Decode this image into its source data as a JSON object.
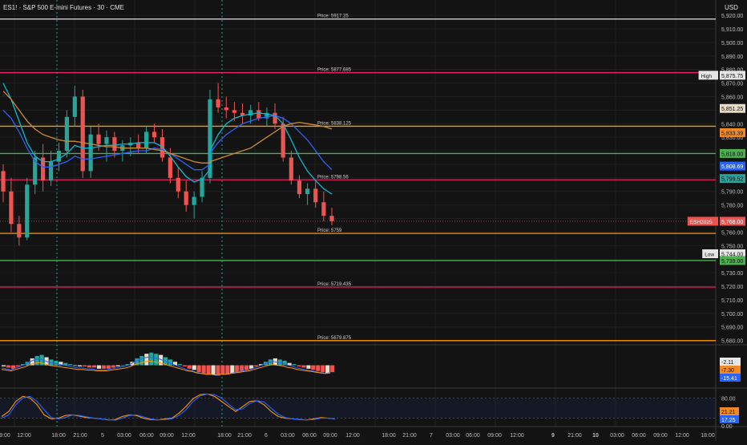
{
  "header": {
    "title": "ES1! · S&P 500 E-mini Futures · 30 · CME",
    "currency": "USD"
  },
  "colors": {
    "bg": "#131313",
    "grid": "#1f1f1f",
    "axis_text": "#bdbdbd",
    "up": "#26a69a",
    "down": "#ef5350",
    "pink": "#e91e63",
    "orange": "#ff9800",
    "green": "#4caf50",
    "white": "#e0e0e0",
    "blue": "#2962ff",
    "teal": "#00bcd4",
    "tan": "#c98a3a"
  },
  "chart_data": [
    {
      "type": "line",
      "name": "main-price",
      "price_axis": [
        "5,920.00",
        "5,910.00",
        "5,900.00",
        "5,890.00",
        "5,880.00",
        "5,870.00",
        "5,860.00",
        "5,850.00",
        "5,840.00",
        "5,830.00",
        "5,820.00",
        "5,810.00",
        "5,800.00",
        "5,790.00",
        "5,780.00",
        "5,770.00",
        "5,760.00",
        "5,750.00",
        "5,740.00",
        "5,730.00",
        "5,720.00",
        "5,710.00",
        "5,700.00",
        "5,690.00",
        "5,680.00"
      ],
      "ylim": [
        5678,
        5923
      ],
      "horizontal_levels": [
        {
          "label": "Price: 5917.25",
          "value": 5917.25,
          "color": "white"
        },
        {
          "label": "Price: 5877.685",
          "value": 5877.685,
          "color": "pink"
        },
        {
          "label": "Price: 5838.125",
          "value": 5838.125,
          "color": "orange"
        },
        {
          "label": "Price: 5798.56",
          "value": 5798.56,
          "color": "pink"
        },
        {
          "label": "Price: 5759",
          "value": 5759,
          "color": "orange"
        },
        {
          "label": "Price: 5719.435",
          "value": 5719.435,
          "color": "pink"
        },
        {
          "label": "Price: 5679.875",
          "value": 5679.875,
          "color": "orange"
        },
        {
          "label": "",
          "value": 5818.0,
          "color": "green"
        },
        {
          "label": "",
          "value": 5739.0,
          "color": "green"
        }
      ],
      "price_tags": [
        {
          "label": "High",
          "text": "5,875.75",
          "value": 5875.75,
          "bg": "#e6e6e6",
          "fg": "#111111"
        },
        {
          "label": "",
          "text": "5,851.25",
          "value": 5851.25,
          "bg": "#e8dccb",
          "fg": "#111111"
        },
        {
          "label": "",
          "text": "5,833.39",
          "value": 5833.39,
          "bg": "#f08a24",
          "fg": "#111111"
        },
        {
          "label": "",
          "text": "5,818.00",
          "value": 5818.0,
          "bg": "#4caf50",
          "fg": "#111111"
        },
        {
          "label": "",
          "text": "5,808.69",
          "value": 5808.69,
          "bg": "#2962ff",
          "fg": "#ffffff"
        },
        {
          "label": "",
          "text": "5,799.52",
          "value": 5799.52,
          "bg": "#26a69a",
          "fg": "#111111"
        },
        {
          "label": "ESH2025",
          "text": "5,768.00",
          "value": 5768.0,
          "bg": "#ef5350",
          "fg": "#ffffff"
        },
        {
          "label": "Low",
          "text": "5,744.00",
          "value": 5744.0,
          "bg": "#e6e6e6",
          "fg": "#111111"
        },
        {
          "label": "",
          "text": "5,739.00",
          "value": 5739.0,
          "bg": "#4caf50",
          "fg": "#111111"
        }
      ],
      "last_price_line": 5768.0,
      "candles": [
        [
          5805,
          5810,
          5782,
          5790
        ],
        [
          5790,
          5800,
          5760,
          5766
        ],
        [
          5766,
          5772,
          5750,
          5756
        ],
        [
          5756,
          5800,
          5754,
          5795
        ],
        [
          5795,
          5820,
          5788,
          5815
        ],
        [
          5815,
          5825,
          5790,
          5798
        ],
        [
          5798,
          5820,
          5794,
          5812
        ],
        [
          5812,
          5826,
          5805,
          5820
        ],
        [
          5820,
          5850,
          5815,
          5845
        ],
        [
          5845,
          5868,
          5838,
          5860
        ],
        [
          5860,
          5865,
          5800,
          5805
        ],
        [
          5805,
          5838,
          5800,
          5832
        ],
        [
          5832,
          5840,
          5820,
          5825
        ],
        [
          5825,
          5835,
          5812,
          5830
        ],
        [
          5830,
          5834,
          5815,
          5820
        ],
        [
          5820,
          5828,
          5812,
          5824
        ],
        [
          5824,
          5830,
          5816,
          5826
        ],
        [
          5826,
          5832,
          5818,
          5822
        ],
        [
          5822,
          5838,
          5818,
          5834
        ],
        [
          5834,
          5840,
          5826,
          5830
        ],
        [
          5830,
          5836,
          5812,
          5815
        ],
        [
          5815,
          5822,
          5796,
          5800
        ],
        [
          5800,
          5808,
          5785,
          5790
        ],
        [
          5790,
          5798,
          5775,
          5780
        ],
        [
          5780,
          5790,
          5770,
          5786
        ],
        [
          5786,
          5805,
          5782,
          5800
        ],
        [
          5800,
          5822,
          5796,
          5818
        ],
        [
          5818,
          5865,
          5814,
          5858
        ],
        [
          5858,
          5870,
          5848,
          5852
        ],
        [
          5852,
          5860,
          5844,
          5850
        ],
        [
          5850,
          5856,
          5842,
          5848
        ],
        [
          5848,
          5855,
          5840,
          5846
        ],
        [
          5846,
          5854,
          5840,
          5850
        ],
        [
          5850,
          5856,
          5842,
          5844
        ],
        [
          5844,
          5852,
          5838,
          5848
        ],
        [
          5848,
          5855,
          5836,
          5840
        ],
        [
          5840,
          5845,
          5812,
          5815
        ],
        [
          5815,
          5820,
          5795,
          5798
        ],
        [
          5798,
          5802,
          5785,
          5788
        ],
        [
          5788,
          5796,
          5780,
          5792
        ],
        [
          5792,
          5798,
          5778,
          5782
        ],
        [
          5782,
          5790,
          5768,
          5772
        ],
        [
          5772,
          5778,
          5765,
          5768
        ]
      ],
      "ma_lines": [
        {
          "color": "blue",
          "values": [
            5850,
            5844,
            5834,
            5822,
            5812,
            5808,
            5808,
            5810,
            5812,
            5816,
            5814,
            5814,
            5815,
            5816,
            5817,
            5818,
            5819,
            5820,
            5820,
            5822,
            5821,
            5818,
            5814,
            5810,
            5806,
            5806,
            5810,
            5818,
            5826,
            5832,
            5836,
            5840,
            5842,
            5844,
            5845,
            5846,
            5844,
            5840,
            5834,
            5828,
            5820,
            5812,
            5806
          ]
        },
        {
          "color": "teal",
          "values": [
            5870,
            5858,
            5842,
            5826,
            5816,
            5812,
            5812,
            5814,
            5818,
            5824,
            5822,
            5822,
            5823,
            5824,
            5824,
            5825,
            5825,
            5826,
            5826,
            5826,
            5823,
            5816,
            5808,
            5801,
            5797,
            5799,
            5806,
            5820,
            5832,
            5840,
            5844,
            5846,
            5847,
            5848,
            5847,
            5846,
            5840,
            5828,
            5815,
            5805,
            5798,
            5792,
            5788
          ]
        },
        {
          "color": "tan",
          "values": [
            5864,
            5858,
            5850,
            5842,
            5836,
            5832,
            5830,
            5828,
            5827,
            5827,
            5826,
            5825,
            5824,
            5823,
            5823,
            5822,
            5822,
            5822,
            5822,
            5821,
            5820,
            5818,
            5816,
            5814,
            5812,
            5811,
            5811,
            5812,
            5814,
            5816,
            5818,
            5820,
            5822,
            5826,
            5830,
            5834,
            5838,
            5840,
            5841,
            5840,
            5839,
            5838,
            5836
          ]
        }
      ]
    },
    {
      "type": "bar",
      "name": "macd",
      "values": [
        -1,
        -2,
        -3,
        -1,
        1,
        3,
        6,
        8,
        9,
        7,
        5,
        4,
        3,
        2,
        1,
        0,
        -1,
        -1,
        -2,
        -2,
        -3,
        -3,
        -3,
        -2,
        -1,
        0,
        1,
        3,
        6,
        8,
        10,
        11,
        10,
        9,
        7,
        5,
        3,
        1,
        -1,
        -3,
        -4,
        -6,
        -7,
        -8,
        -8,
        -9,
        -8,
        -8,
        -7,
        -6,
        -5,
        -4,
        -3,
        -1,
        1,
        3,
        5,
        6,
        5,
        4,
        2,
        1,
        -1,
        -2,
        -3,
        -4,
        -5,
        -6,
        -7,
        -6
      ],
      "ylim": [
        -17,
        15
      ],
      "labels": [
        "-2.11",
        "-7.30",
        "-15.41"
      ]
    },
    {
      "type": "line",
      "name": "stochastic",
      "ticks": [
        "80.00",
        "0.00"
      ],
      "ylim": [
        0,
        100
      ],
      "tags": [
        "21.21",
        "17.25"
      ],
      "series": [
        {
          "color": "orange",
          "values": [
            25,
            40,
            70,
            85,
            80,
            60,
            30,
            18,
            20,
            28,
            30,
            26,
            22,
            20,
            18,
            15,
            16,
            25,
            30,
            28,
            20,
            16,
            15,
            18,
            20,
            35,
            55,
            78,
            90,
            92,
            85,
            70,
            55,
            40,
            55,
            70,
            72,
            60,
            40,
            25,
            20,
            18,
            16,
            15,
            18,
            22,
            20,
            18
          ]
        },
        {
          "color": "blue",
          "values": [
            20,
            30,
            60,
            80,
            85,
            70,
            45,
            22,
            18,
            22,
            30,
            28,
            24,
            20,
            18,
            16,
            14,
            20,
            28,
            30,
            24,
            18,
            15,
            16,
            18,
            28,
            45,
            70,
            86,
            92,
            90,
            80,
            62,
            45,
            48,
            64,
            72,
            68,
            50,
            32,
            22,
            18,
            17,
            15,
            16,
            20,
            20,
            18
          ]
        }
      ]
    }
  ],
  "time_axis": [
    "9:00",
    "12:00",
    "18:00",
    "21:00",
    "5",
    "03:00",
    "06:00",
    "09:00",
    "12:00",
    "18:00",
    "21:00",
    "6",
    "03:00",
    "06:00",
    "09:00",
    "12:00",
    "18:00",
    "21:00",
    "03:00",
    "06:00",
    "09:00",
    "12:00",
    "9",
    "21:00",
    "10",
    "03:00",
    "06:00",
    "09:00",
    "12:00",
    "18:00"
  ],
  "date_axis": [
    "7"
  ],
  "pane_labels": {
    "macd": "",
    "stoch": ""
  }
}
